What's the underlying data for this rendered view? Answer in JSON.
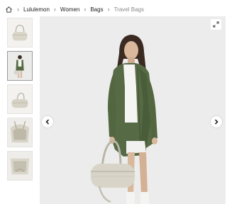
{
  "breadcrumb": {
    "home_icon": "home-icon",
    "separator_icon": "chevron-right-icon",
    "items": [
      {
        "label": "Lululemon"
      },
      {
        "label": "Women"
      },
      {
        "label": "Bags"
      },
      {
        "label": "Travel Bags"
      }
    ]
  },
  "gallery": {
    "thumbnails": [
      "duffel-bag-front",
      "model-with-bag",
      "duffel-bag-side",
      "bag-interior-open",
      "bag-interior-top"
    ],
    "active_index": 1,
    "main_image": "model-in-green-jacket-holding-duffel-bag",
    "controls": {
      "expand_icon": "expand-icon",
      "prev_icon": "chevron-left-icon",
      "next_icon": "chevron-right-icon"
    }
  },
  "colors": {
    "jacket": "#566b45",
    "bag": "#d8d5c8",
    "background": "#ececec",
    "border": "#e3e3e3"
  }
}
